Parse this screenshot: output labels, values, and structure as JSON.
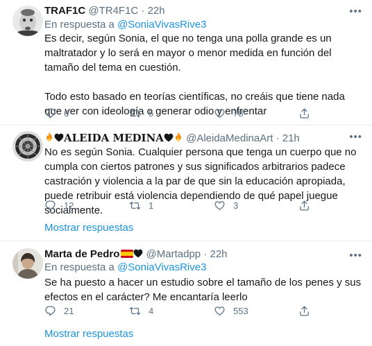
{
  "tweets": [
    {
      "name": "TRAF1C",
      "handle": "@TR4F1C",
      "sep": "·",
      "time": "22h",
      "reply_prefix": "En respuesta a",
      "reply_to": "@SoniaVivasRive3",
      "text": "Es decir, según Sonia, el que no tenga una polla grande es un maltratador y lo será en mayor o menor medida en función del tamaño del tema en cuestión.\n\nTodo esto basado en teorías científicas, no creáis que tiene nada que ver con ideología o generar odio y enfrentar",
      "replies": "6",
      "retweets": "5",
      "likes": "78",
      "more": "•••"
    },
    {
      "name": "ALEIDA MEDINA",
      "handle": "@AleidaMedinaArt",
      "sep": "·",
      "time": "21h",
      "text": "No es según Sonia. Cualquier persona que tenga un cuerpo que no cumpla con ciertos patrones y sus significados arbitrarios padece castración y violencia a la par de que sin la educación apropiada, puede retribuir está violencia dependiendo de qué papel juegue socialmente.",
      "replies": "12",
      "retweets": "1",
      "likes": "3",
      "more": "•••",
      "show_replies": "Mostrar respuestas"
    },
    {
      "name": "Marta de Pedro",
      "handle": "@Martadpp",
      "sep": "·",
      "time": "22h",
      "reply_prefix": "En respuesta a",
      "reply_to": "@SoniaVivasRive3",
      "text": "Se ha puesto a hacer un estudio sobre el tamaño de los penes y sus efectos en el carácter? Me encantaría leerlo",
      "replies": "21",
      "retweets": "4",
      "likes": "553",
      "more": "•••",
      "show_replies": "Mostrar respuestas"
    }
  ],
  "colors": {
    "link": "#1b95e0",
    "muted": "#5b7083",
    "divider": "#e6ecf0"
  },
  "icons": [
    "reply-icon",
    "retweet-icon",
    "like-icon",
    "share-icon",
    "more-icon"
  ]
}
